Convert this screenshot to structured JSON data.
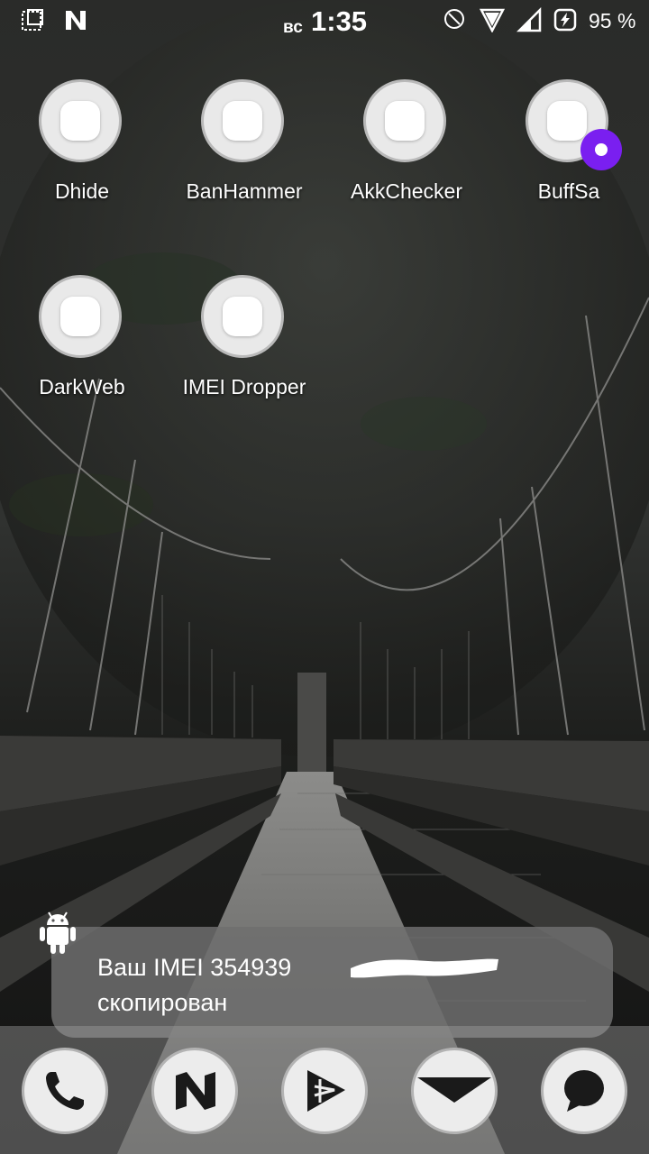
{
  "status_bar": {
    "day": "вс",
    "time": "1:35",
    "battery_percent": "95 %",
    "left_icons": [
      "screenshot-icon",
      "n-logo-icon"
    ],
    "right_icons": [
      "do-not-disturb-icon",
      "wifi-icon",
      "cell-signal-icon",
      "battery-charging-icon"
    ]
  },
  "apps": [
    {
      "label": "Dhide",
      "icon": "app-icon"
    },
    {
      "label": "BanHammer",
      "icon": "app-icon"
    },
    {
      "label": "AkkChecker",
      "icon": "app-icon"
    },
    {
      "label": "BuffSa",
      "icon": "app-icon",
      "badge": true
    },
    {
      "label": "DarkWeb",
      "icon": "app-icon"
    },
    {
      "label": "IMEI Dropper",
      "icon": "app-icon"
    }
  ],
  "toast": {
    "line1": "Ваш IMEI 354939",
    "line2": "скопирован",
    "icon": "android-icon"
  },
  "dock": {
    "items": [
      "phone-icon",
      "n-app-icon",
      "play-store-icon",
      "mail-icon",
      "messages-icon"
    ]
  },
  "colors": {
    "badge": "#7a1ff0",
    "toast_bg": "#6e6e6e",
    "icon_bg": "#e9e9e9"
  }
}
